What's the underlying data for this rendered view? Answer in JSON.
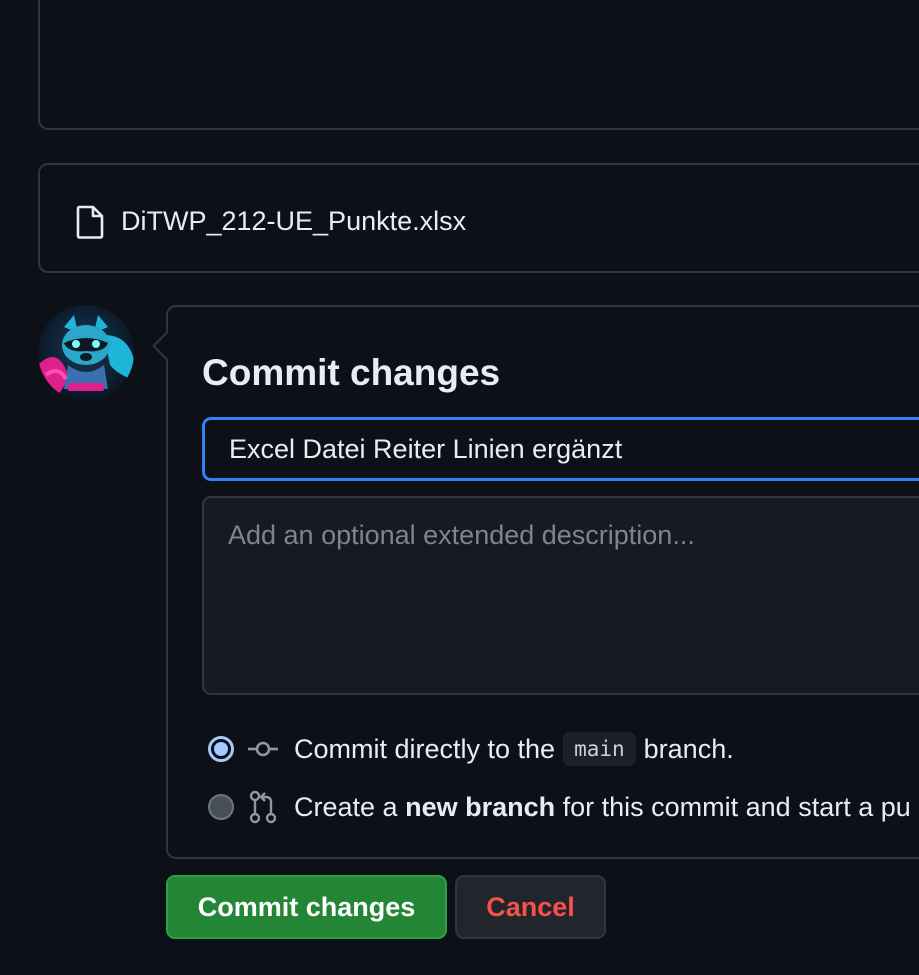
{
  "file": {
    "icon": "file-icon",
    "name": "DiTWP_212-UE_Punkte.xlsx"
  },
  "avatar": {
    "icon": "user-avatar"
  },
  "commit": {
    "title": "Commit changes",
    "summary_value": "Excel Datei Reiter Linien ergänzt",
    "description_placeholder": "Add an optional extended description...",
    "option_direct": {
      "prefix": "Commit directly to the",
      "branch": "main",
      "suffix": "branch.",
      "selected": true,
      "icon": "git-commit-icon"
    },
    "option_new_branch": {
      "prefix": "Create a",
      "bold": "new branch",
      "suffix": "for this commit and start a pu",
      "selected": false,
      "icon": "git-pull-request-icon"
    }
  },
  "buttons": {
    "commit_label": "Commit changes",
    "cancel_label": "Cancel"
  },
  "colors": {
    "background": "#0d1117",
    "border": "#30363d",
    "focus": "#2f81f7",
    "primary": "#238636",
    "danger": "#f85149"
  }
}
